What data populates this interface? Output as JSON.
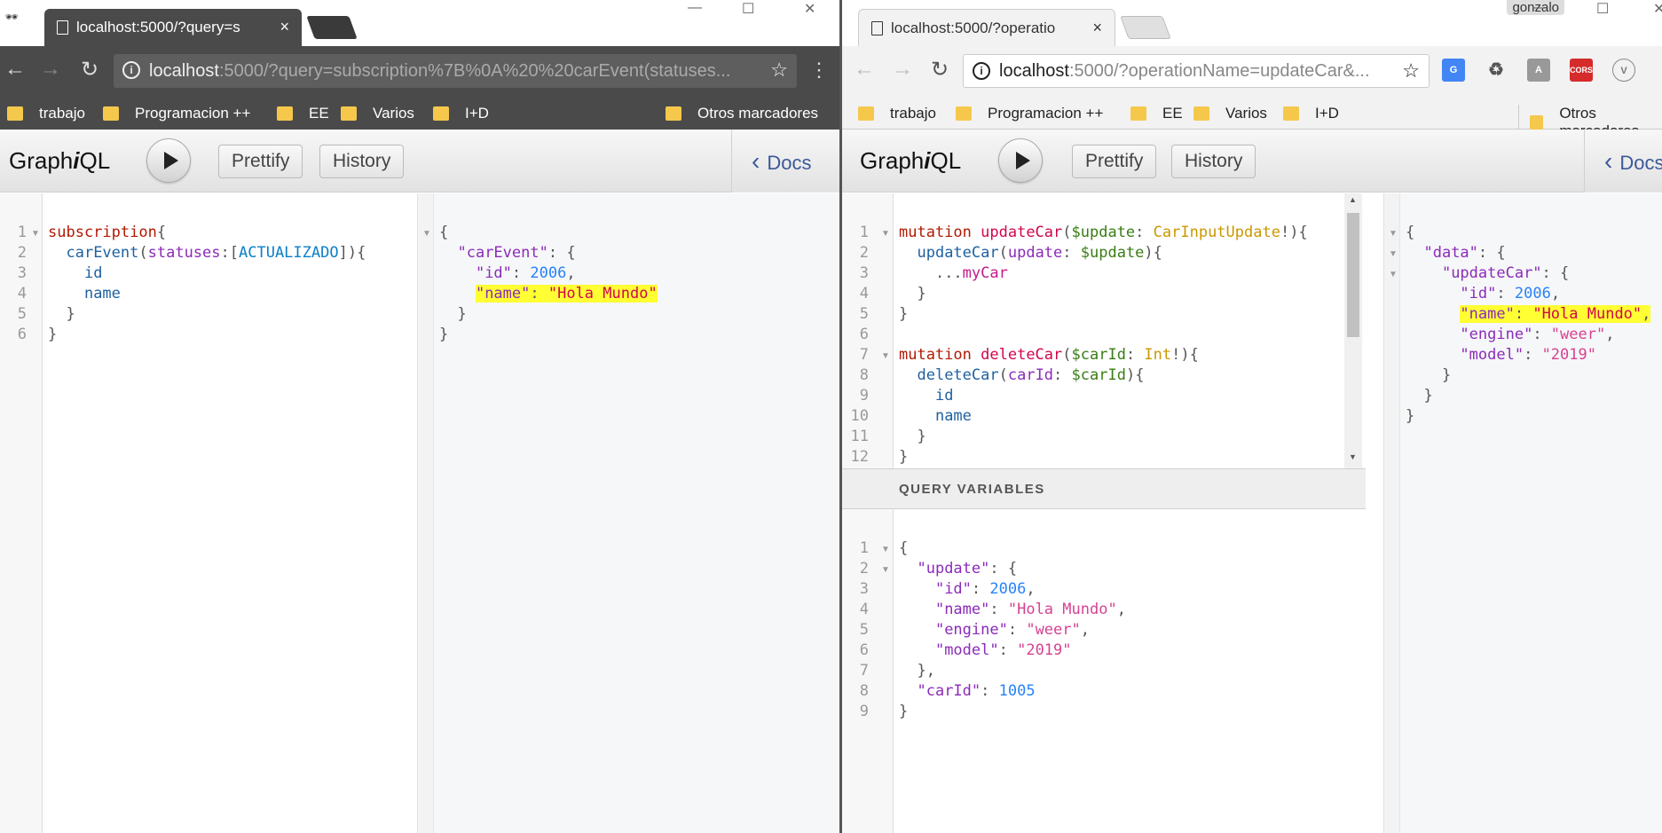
{
  "left": {
    "tab_title": "localhost:5000/?query=s",
    "tab_close": "×",
    "incognito_icon": "🕶",
    "url_host": "localhost",
    "url_rest": ":5000/?query=subscription%7B%0A%20%20carEvent(statuses...",
    "bookmarks": [
      "trabajo",
      "Programacion ++",
      "EE",
      "Varios",
      "I+D"
    ],
    "other_bookmarks": "Otros marcadores",
    "logo_pre": "Graph",
    "logo_i": "i",
    "logo_post": "QL",
    "prettify": "Prettify",
    "history": "History",
    "docs": "Docs"
  },
  "right": {
    "tab_title": "localhost:5000/?operatio",
    "tab_close": "×",
    "user": "gonzalo",
    "url_host": "localhost",
    "url_rest": ":5000/?operationName=updateCar&...",
    "bookmarks": [
      "trabajo",
      "Programacion ++",
      "EE",
      "Varios",
      "I+D"
    ],
    "other_bookmarks": "Otros marcadores",
    "ext_cors": "CORS",
    "ext_v": "V",
    "logo_pre": "Graph",
    "logo_i": "i",
    "logo_post": "QL",
    "prettify": "Prettify",
    "history": "History",
    "docs": "Docs",
    "query_variables_title": "QUERY VARIABLES"
  },
  "window_controls": {
    "minimize": "—",
    "maximize": "☐",
    "close": "✕"
  },
  "colors": {
    "highlight": "#ffff33",
    "docs_link": "#3b5998"
  }
}
